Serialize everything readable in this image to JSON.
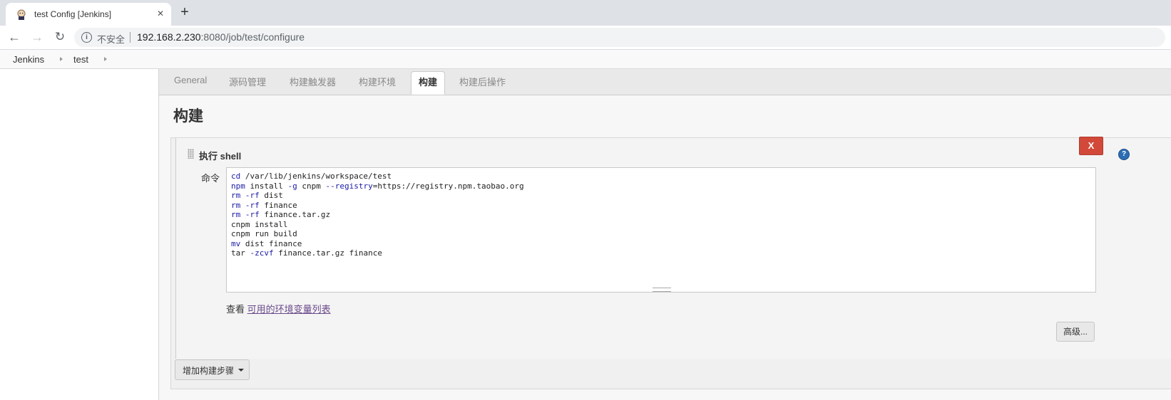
{
  "browser": {
    "tab_title": "test Config [Jenkins]",
    "tab_close": "✕",
    "new_tab": "+",
    "back": "←",
    "forward": "→",
    "reload": "↻",
    "info": "i",
    "security_label": "不安全",
    "url_host": "192.168.2.230",
    "url_rest": ":8080/job/test/configure"
  },
  "breadcrumbs": [
    "Jenkins",
    "test"
  ],
  "config_tabs": [
    {
      "label": "General",
      "active": false
    },
    {
      "label": "源码管理",
      "active": false
    },
    {
      "label": "构建触发器",
      "active": false
    },
    {
      "label": "构建环境",
      "active": false
    },
    {
      "label": "构建",
      "active": true
    },
    {
      "label": "构建后操作",
      "active": false
    }
  ],
  "section_title": "构建",
  "build_step": {
    "title": "执行 shell",
    "delete_label": "X",
    "help_label": "?",
    "command_label": "命令",
    "command_lines": [
      [
        {
          "t": "cd",
          "k": true
        },
        {
          "t": " /var/lib/jenkins/workspace/test"
        }
      ],
      [
        {
          "t": "npm",
          "k": true
        },
        {
          "t": " install "
        },
        {
          "t": "-g",
          "k": true
        },
        {
          "t": " cnpm "
        },
        {
          "t": "--registry",
          "k": true
        },
        {
          "t": "=https://registry.npm.taobao.org"
        }
      ],
      [
        {
          "t": "rm",
          "k": true
        },
        {
          "t": " "
        },
        {
          "t": "-rf",
          "k": true
        },
        {
          "t": " dist"
        }
      ],
      [
        {
          "t": "rm",
          "k": true
        },
        {
          "t": " "
        },
        {
          "t": "-rf",
          "k": true
        },
        {
          "t": " finance"
        }
      ],
      [
        {
          "t": "rm",
          "k": true
        },
        {
          "t": " "
        },
        {
          "t": "-rf",
          "k": true
        },
        {
          "t": " finance.tar.gz"
        }
      ],
      [
        {
          "t": "cnpm install"
        }
      ],
      [
        {
          "t": "cnpm run build"
        }
      ],
      [
        {
          "t": "mv",
          "k": true
        },
        {
          "t": " dist finance"
        }
      ],
      [
        {
          "t": "tar "
        },
        {
          "t": "-zcvf",
          "k": true
        },
        {
          "t": " finance.tar.gz finance"
        }
      ]
    ],
    "env_prefix": "查看",
    "env_link": "可用的环境变量列表",
    "advanced_label": "高级..."
  },
  "add_step_label": "增加构建步骤",
  "colors": {
    "delete_red": "#d24939",
    "help_blue": "#2d6db5",
    "keyword": "#1a1aa6",
    "link": "#6a4a8c"
  }
}
